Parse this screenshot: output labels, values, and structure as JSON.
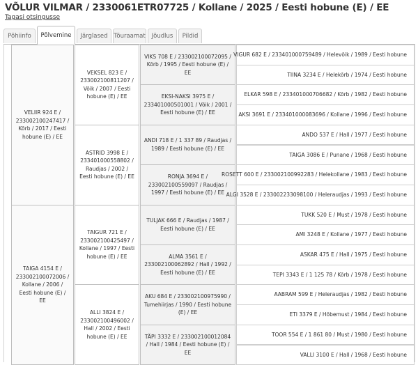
{
  "page": {
    "title": "VÕLUR VILMAR / 2330061ETR07725 / Kollane / 2025 / Eesti hobune (E) / EE",
    "back_link": "Tagasi otsingusse"
  },
  "tabs": [
    {
      "label": "Põhiinfo",
      "active": false
    },
    {
      "label": "Põlvemine",
      "active": true
    },
    {
      "label": "Järglased",
      "active": false
    },
    {
      "label": "Tõuraamat",
      "active": false
    },
    {
      "label": "Jõudlus",
      "active": false
    },
    {
      "label": "Pildid",
      "active": false
    }
  ],
  "pedigree": {
    "gen1": [
      {
        "name": "VELIIR",
        "info": " 924 E / 233002100247417 / Kõrb / 2017 / Eesti hobune (E) / EE"
      },
      {
        "name": "TAIGA",
        "info": " 4154 E / 233002100072006 / Kollane / 2006 / Eesti hobune (E) / EE"
      }
    ],
    "gen2": [
      {
        "name": "VEKSEL",
        "info": " 823 E / 233002100811207 / Võik / 2007 / Eesti hobune (E) / EE"
      },
      {
        "name": "ASTRID",
        "info": " 3998 E / 233401000558802 / Raudjas / 2002 / Eesti hobune (E) / EE"
      },
      {
        "name": "TAIGUR",
        "info": " 721 E / 233002100425497 / Kollane / 1997 / Eesti hobune (E) / EE"
      },
      {
        "name": "ALLI",
        "info": " 3824 E / 233002100496002 / Hall / 2002 / Eesti hobune (E) / EE"
      }
    ],
    "gen3": [
      {
        "name": "VIKS",
        "info": " 708 E / 233002100072095 / Kõrb / 1995 / Eesti hobune (E) / EE"
      },
      {
        "name": "EKSI-NAKSI",
        "info": " 3975 E / 233401000501001 / Võik / 2001 / Eesti hobune (E) / EE"
      },
      {
        "name": "ANDI",
        "info": " 718 E / 1 337 89 / Raudjas / 1989 / Eesti hobune (E) / EE"
      },
      {
        "name": "RONJA",
        "info": " 3694 E / 233002100559097 / Raudjas / 1997 / Eesti hobune (E) / EE"
      },
      {
        "name": "TULJAK",
        "info": " 666 E / Raudjas / 1987 / Eesti hobune (E) / EE"
      },
      {
        "name": "ALMA",
        "info": " 3561 E / 233002100062892 / Hall / 1992 / Eesti hobune (E) / EE"
      },
      {
        "name": "AKU",
        "info": " 684 E / 233002100975990 / Tumehiirjas / 1990 / Eesti hobune (E) / EE"
      },
      {
        "name": "TÄPI",
        "info": " 3332 E / 233002100012084 / Hall / 1984 / Eesti hobune (E) / EE"
      }
    ],
    "gen4": [
      {
        "name": "VIGUR",
        "info": " 682 E / 233401000759489 / Helevõik / 1989 / Eesti hobune"
      },
      {
        "name": "TIINA",
        "info": " 3234 E / Helekõrb / 1974 / Eesti hobune"
      },
      {
        "name": "ELKAR",
        "info": " 598 E / 233401000706682 / Kõrb / 1982 / Eesti hobune"
      },
      {
        "name": "AKSI",
        "info": " 3691 E / 233401000083696 / Kollane / 1996 / Eesti hobune"
      },
      {
        "name": "ANDO",
        "info": " 537 E / Hall / 1977 / Eesti hobune"
      },
      {
        "name": "TAIGA",
        "info": " 3086 E / Punane / 1968 / Eesti hobune"
      },
      {
        "name": "ROSETT",
        "info": " 600 E / 233002100992283 / Helekollane / 1983 / Eesti hobune"
      },
      {
        "name": "ALGI",
        "info": " 3528 E / 233002233098100 / Heleraudjas / 1993 / Eesti hobune"
      },
      {
        "name": "TUKK",
        "info": " 520 E / Must / 1978 / Eesti hobune"
      },
      {
        "name": "AMI",
        "info": " 3248 E / Kollane / 1977 / Eesti hobune"
      },
      {
        "name": "ASKAR",
        "info": " 475 E / Hall / 1975 / Eesti hobune"
      },
      {
        "name": "TEPI",
        "info": " 3343 E / 1 125 78 / Kõrb / 1978 / Eesti hobune"
      },
      {
        "name": "AABRAM",
        "info": " 599 E / Heleraudjas / 1982 / Eesti hobune"
      },
      {
        "name": "ETI",
        "info": " 3379 E / Hõbemust / 1984 / Eesti hobune"
      },
      {
        "name": "TOOR",
        "info": " 554 E / 1 861 80 / Must / 1980 / Eesti hobune"
      },
      {
        "name": "VALLI",
        "info": " 3100 E / Hall / 1968 / Eesti hobune"
      }
    ]
  }
}
